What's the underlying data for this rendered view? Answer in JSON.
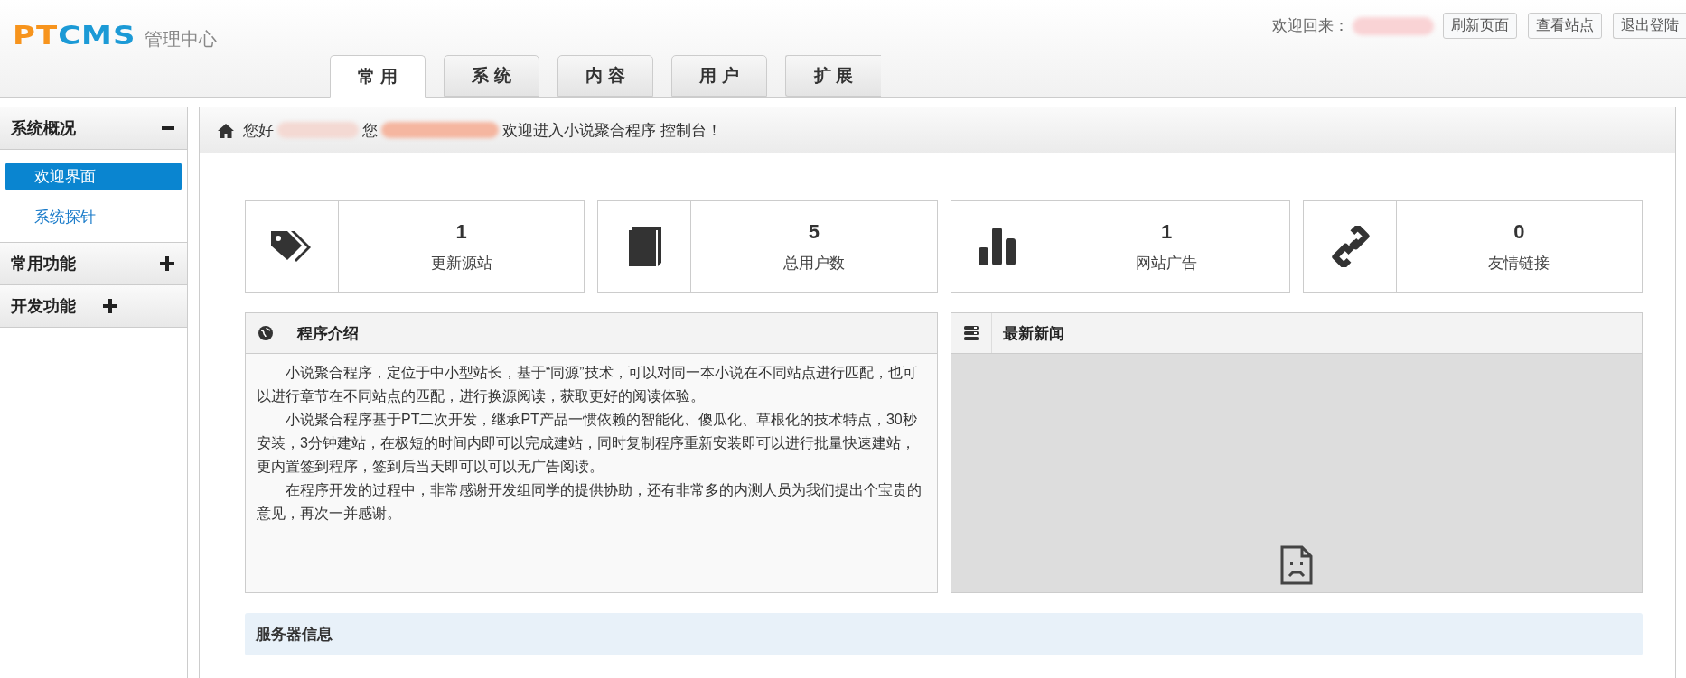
{
  "header": {
    "logo": {
      "part1": "PT",
      "part2": "CMS"
    },
    "subtitle": "管理中心",
    "welcome": "欢迎回来：",
    "buttons": [
      "刷新页面",
      "查看站点",
      "退出登陆"
    ]
  },
  "tabs": [
    {
      "label": "常 用",
      "selected": true
    },
    {
      "label": "系 统",
      "selected": false
    },
    {
      "label": "内 容",
      "selected": false
    },
    {
      "label": "用 户",
      "selected": false
    },
    {
      "label": "扩 展",
      "selected": false
    }
  ],
  "sidebar": {
    "groups": [
      {
        "title": "系统概况",
        "expanded": true,
        "items": [
          {
            "label": "欢迎界面",
            "selected": true
          },
          {
            "label": "系统探针",
            "selected": false
          }
        ]
      },
      {
        "title": "常用功能",
        "expanded": false
      },
      {
        "title": "开发功能",
        "expanded": false
      }
    ]
  },
  "breadcrumb": {
    "greeting": "您好",
    "you": "您",
    "message": "欢迎进入小说聚合程序 控制台！"
  },
  "stats": [
    {
      "value": "1",
      "label": "更新源站"
    },
    {
      "value": "5",
      "label": "总用户数"
    },
    {
      "value": "1",
      "label": "网站广告"
    },
    {
      "value": "0",
      "label": "友情链接"
    }
  ],
  "intro": {
    "title": "程序介绍",
    "paragraphs": [
      "小说聚合程序，定位于中小型站长，基于“同源”技术，可以对同一本小说在不同站点进行匹配，也可以进行章节在不同站点的匹配，进行换源阅读，获取更好的阅读体验。",
      "小说聚合程序基于PT二次开发，继承PT产品一惯依赖的智能化、傻瓜化、草根化的技术特点，30秒安装，3分钟建站，在极短的时间内即可以完成建站，同时复制程序重新安装即可以进行批量快速建站，更内置签到程序，签到后当天即可以可以无广告阅读。",
      "在程序开发的过程中，非常感谢开发组同学的提供协助，还有非常多的内测人员为我们提出个宝贵的意见，再次一并感谢。"
    ]
  },
  "news": {
    "title": "最新新闻"
  },
  "server_info": {
    "title": "服务器信息"
  }
}
